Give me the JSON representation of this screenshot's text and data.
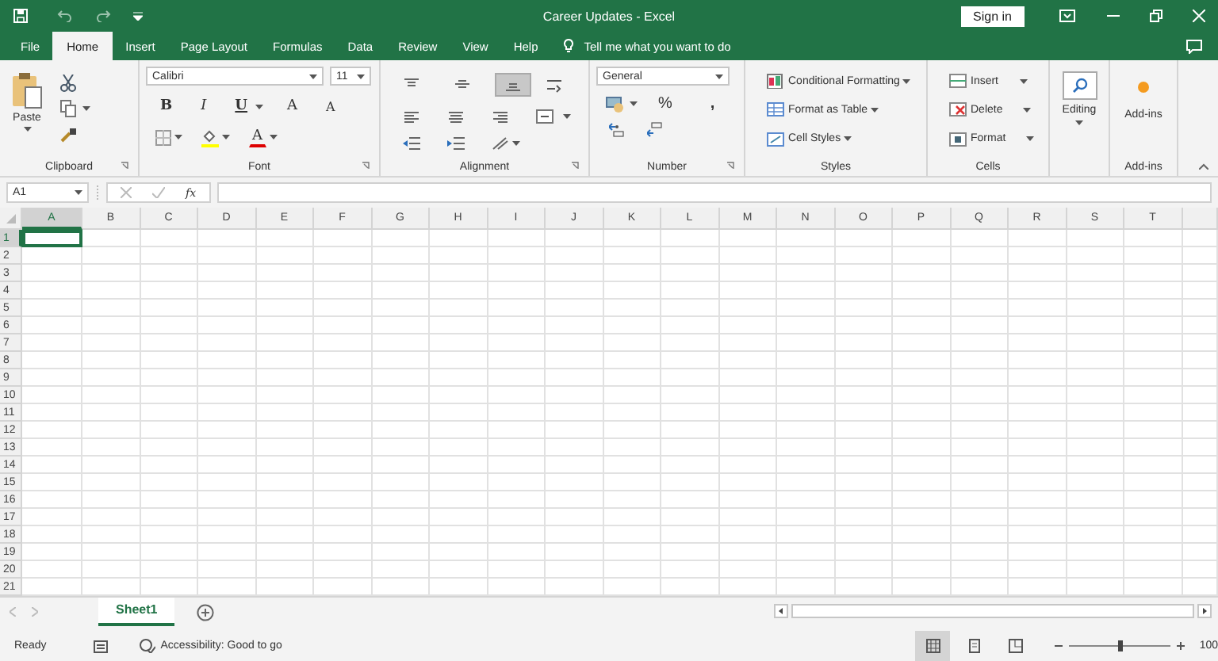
{
  "title_bar": {
    "title": "Career Updates  -  Excel",
    "sign_in": "Sign in"
  },
  "tabs": [
    {
      "label": "File",
      "selected": false
    },
    {
      "label": "Home",
      "selected": true
    },
    {
      "label": "Insert",
      "selected": false
    },
    {
      "label": "Page Layout",
      "selected": false
    },
    {
      "label": "Formulas",
      "selected": false
    },
    {
      "label": "Data",
      "selected": false
    },
    {
      "label": "Review",
      "selected": false
    },
    {
      "label": "View",
      "selected": false
    },
    {
      "label": "Help",
      "selected": false
    }
  ],
  "tell_me": {
    "placeholder": "Tell me what you want to do"
  },
  "ribbon": {
    "clipboard": {
      "paste": "Paste",
      "label": "Clipboard"
    },
    "font": {
      "font_name": "Calibri",
      "font_size": "11",
      "bold": "B",
      "italic": "I",
      "underline": "U",
      "grow": "A",
      "shrink": "A",
      "font_color": "A",
      "label": "Font"
    },
    "alignment": {
      "vertical": [
        {
          "selected": false
        },
        {
          "selected": false
        },
        {
          "selected": true
        }
      ],
      "label": "Alignment"
    },
    "number": {
      "format": "General",
      "percent": "%",
      "comma": ",",
      "label": "Number"
    },
    "styles": {
      "items": [
        "Conditional Formatting",
        "Format as Table",
        "Cell Styles"
      ],
      "label": "Styles"
    },
    "cells": {
      "items": [
        "Insert",
        "Delete",
        "Format"
      ],
      "label": "Cells"
    },
    "editing": {
      "button": "Editing"
    },
    "add_ins": {
      "button": "Add-ins",
      "label": "Add-ins"
    }
  },
  "formula_bar": {
    "name_box": "A1",
    "fx": "fx"
  },
  "sheet": {
    "columns": [
      {
        "label": "A",
        "selected": true
      },
      {
        "label": "B",
        "selected": false
      },
      {
        "label": "C",
        "selected": false
      },
      {
        "label": "D",
        "selected": false
      },
      {
        "label": "E",
        "selected": false
      },
      {
        "label": "F",
        "selected": false
      },
      {
        "label": "G",
        "selected": false
      },
      {
        "label": "H",
        "selected": false
      },
      {
        "label": "I",
        "selected": false
      },
      {
        "label": "J",
        "selected": false
      },
      {
        "label": "K",
        "selected": false
      },
      {
        "label": "L",
        "selected": false
      },
      {
        "label": "M",
        "selected": false
      },
      {
        "label": "N",
        "selected": false
      },
      {
        "label": "O",
        "selected": false
      },
      {
        "label": "P",
        "selected": false
      },
      {
        "label": "Q",
        "selected": false
      },
      {
        "label": "R",
        "selected": false
      },
      {
        "label": "S",
        "selected": false
      },
      {
        "label": "T",
        "selected": false
      }
    ],
    "rows": [
      {
        "label": "1",
        "selected": true
      },
      {
        "label": "2",
        "selected": false
      },
      {
        "label": "3",
        "selected": false
      },
      {
        "label": "4",
        "selected": false
      },
      {
        "label": "5",
        "selected": false
      },
      {
        "label": "6",
        "selected": false
      },
      {
        "label": "7",
        "selected": false
      },
      {
        "label": "8",
        "selected": false
      },
      {
        "label": "9",
        "selected": false
      },
      {
        "label": "10",
        "selected": false
      },
      {
        "label": "11",
        "selected": false
      },
      {
        "label": "12",
        "selected": false
      },
      {
        "label": "13",
        "selected": false
      },
      {
        "label": "14",
        "selected": false
      },
      {
        "label": "15",
        "selected": false
      },
      {
        "label": "16",
        "selected": false
      },
      {
        "label": "17",
        "selected": false
      },
      {
        "label": "18",
        "selected": false
      },
      {
        "label": "19",
        "selected": false
      },
      {
        "label": "20",
        "selected": false
      },
      {
        "label": "21",
        "selected": false
      }
    ]
  },
  "sheet_tabs": [
    {
      "label": "Sheet1",
      "selected": true
    }
  ],
  "status_bar": {
    "status": "Ready",
    "accessibility": "Accessibility: Good to go",
    "views": [
      {
        "selected": true
      },
      {
        "selected": false
      },
      {
        "selected": false
      }
    ],
    "zoom_slider": {
      "level": 0.5
    },
    "zoom": "100"
  }
}
